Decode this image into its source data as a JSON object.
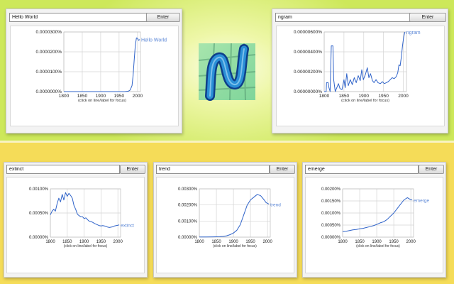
{
  "colors": {
    "accent_line": "#2f63c9",
    "legend_text": "#5a86d6",
    "grid": "#d4d4d4",
    "top_background": "#cde85a",
    "bottom_background": "#f5dc58"
  },
  "logo": {
    "icon": "ngram-viewer-logo-icon",
    "letter": "N"
  },
  "hint": "(click on line/label for focus)",
  "panels": [
    {
      "query": "Hello World",
      "button": "Enter",
      "chart_data": {
        "type": "line",
        "title": "",
        "xlim": [
          1800,
          2008
        ],
        "x_ticks": [
          "1800",
          "1850",
          "1900",
          "1950",
          "2000"
        ],
        "y_ticks": [
          "0.0000000%",
          "0.0000100%",
          "0.0000200%",
          "0.0000300%"
        ],
        "ylim": [
          0,
          3e-05
        ],
        "legend": "top-right",
        "series": [
          {
            "name": "Hello World",
            "points": [
              [
                1800,
                0
              ],
              [
                1850,
                0
              ],
              [
                1900,
                0
              ],
              [
                1950,
                0
              ],
              [
                1965,
                0
              ],
              [
                1975,
                2e-07
              ],
              [
                1980,
                8e-07
              ],
              [
                1985,
                3e-06
              ],
              [
                1988,
                8e-06
              ],
              [
                1991,
                1.6e-05
              ],
              [
                1994,
                2.3e-05
              ],
              [
                1997,
                2.7e-05
              ],
              [
                2000,
                2.68e-05
              ],
              [
                2003,
                2.58e-05
              ],
              [
                2006,
                2.62e-05
              ]
            ]
          }
        ]
      }
    },
    {
      "query": "ngram",
      "button": "Enter",
      "chart_data": {
        "type": "line",
        "title": "",
        "xlim": [
          1800,
          2008
        ],
        "x_ticks": [
          "1800",
          "1850",
          "1900",
          "1950",
          "2000"
        ],
        "y_ticks": [
          "0.00000000%",
          "0.00000200%",
          "0.00000400%",
          "0.00000600%"
        ],
        "ylim": [
          0,
          6e-06
        ],
        "legend": "top-right",
        "series": [
          {
            "name": "ngram",
            "points": [
              [
                1800,
                0
              ],
              [
                1805,
                0
              ],
              [
                1806,
                9e-07
              ],
              [
                1810,
                9e-07
              ],
              [
                1812,
                4e-07
              ],
              [
                1815,
                0
              ],
              [
                1818,
                4.6e-06
              ],
              [
                1822,
                4.6e-06
              ],
              [
                1824,
                1.2e-06
              ],
              [
                1828,
                0
              ],
              [
                1832,
                4e-07
              ],
              [
                1836,
                8e-07
              ],
              [
                1840,
                3e-07
              ],
              [
                1845,
                2e-07
              ],
              [
                1850,
                1.2e-06
              ],
              [
                1853,
                4e-07
              ],
              [
                1857,
                1.8e-06
              ],
              [
                1861,
                6e-07
              ],
              [
                1866,
                1.2e-06
              ],
              [
                1871,
                7e-07
              ],
              [
                1876,
                1.4e-06
              ],
              [
                1881,
                9e-07
              ],
              [
                1886,
                1.6e-06
              ],
              [
                1891,
                1.1e-06
              ],
              [
                1895,
                2.2e-06
              ],
              [
                1899,
                1.2e-06
              ],
              [
                1904,
                1.7e-06
              ],
              [
                1909,
                2.4e-06
              ],
              [
                1913,
                1.4e-06
              ],
              [
                1917,
                1.8e-06
              ],
              [
                1922,
                1.1e-06
              ],
              [
                1926,
                9e-07
              ],
              [
                1931,
                1.2e-06
              ],
              [
                1936,
                9e-07
              ],
              [
                1942,
                8e-07
              ],
              [
                1947,
                1e-06
              ],
              [
                1952,
                8e-07
              ],
              [
                1957,
                9e-07
              ],
              [
                1962,
                1e-06
              ],
              [
                1967,
                1.2e-06
              ],
              [
                1972,
                1.4e-06
              ],
              [
                1977,
                1.3e-06
              ],
              [
                1982,
                1.5e-06
              ],
              [
                1986,
                1.9e-06
              ],
              [
                1989,
                2.7e-06
              ],
              [
                1992,
                2.6e-06
              ],
              [
                1995,
                3.5e-06
              ],
              [
                1998,
                4.6e-06
              ],
              [
                2001,
                5.5e-06
              ],
              [
                2004,
                6e-06
              ]
            ]
          }
        ]
      }
    },
    {
      "query": "extinct",
      "button": "Enter",
      "chart_data": {
        "type": "line",
        "title": "",
        "xlim": [
          1800,
          2008
        ],
        "x_ticks": [
          "1800",
          "1850",
          "1900",
          "1950",
          "2000"
        ],
        "y_ticks": [
          "0.00000%",
          "0.00050%",
          "0.00100%"
        ],
        "ylim": [
          0,
          0.0013
        ],
        "legend": "right",
        "series": [
          {
            "name": "extinct",
            "points": [
              [
                1800,
                0.0006
              ],
              [
                1805,
                0.0007
              ],
              [
                1810,
                0.00075
              ],
              [
                1815,
                0.0007
              ],
              [
                1820,
                0.0009
              ],
              [
                1825,
                0.00105
              ],
              [
                1830,
                0.00095
              ],
              [
                1835,
                0.00115
              ],
              [
                1840,
                0.001
              ],
              [
                1845,
                0.0012
              ],
              [
                1850,
                0.0011
              ],
              [
                1855,
                0.00118
              ],
              [
                1860,
                0.00112
              ],
              [
                1865,
                0.00105
              ],
              [
                1870,
                0.00085
              ],
              [
                1875,
                0.00075
              ],
              [
                1880,
                0.00062
              ],
              [
                1885,
                0.00058
              ],
              [
                1890,
                0.00055
              ],
              [
                1895,
                0.00055
              ],
              [
                1900,
                0.0005
              ],
              [
                1905,
                0.00052
              ],
              [
                1910,
                0.00047
              ],
              [
                1915,
                0.00043
              ],
              [
                1920,
                0.00042
              ],
              [
                1925,
                0.0004
              ],
              [
                1930,
                0.00037
              ],
              [
                1935,
                0.00035
              ],
              [
                1940,
                0.00033
              ],
              [
                1945,
                0.00031
              ],
              [
                1950,
                0.0003
              ],
              [
                1955,
                0.00031
              ],
              [
                1960,
                0.0003
              ],
              [
                1965,
                0.00029
              ],
              [
                1970,
                0.00027
              ],
              [
                1975,
                0.00026
              ],
              [
                1980,
                0.00027
              ],
              [
                1985,
                0.00028
              ],
              [
                1990,
                0.0003
              ],
              [
                1995,
                0.00031
              ],
              [
                2000,
                0.00032
              ],
              [
                2004,
                0.00033
              ]
            ]
          }
        ]
      }
    },
    {
      "query": "trend",
      "button": "Enter",
      "chart_data": {
        "type": "line",
        "title": "",
        "xlim": [
          1800,
          2008
        ],
        "x_ticks": [
          "1800",
          "1850",
          "1900",
          "1950",
          "2000"
        ],
        "y_ticks": [
          "0.00000%",
          "0.00100%",
          "0.00200%",
          "0.00300%"
        ],
        "ylim": [
          0,
          0.0035
        ],
        "legend": "right",
        "series": [
          {
            "name": "trend",
            "points": [
              [
                1800,
                1e-05
              ],
              [
                1820,
                1e-05
              ],
              [
                1840,
                2e-05
              ],
              [
                1860,
                3e-05
              ],
              [
                1870,
                5e-05
              ],
              [
                1880,
                0.0001
              ],
              [
                1890,
                0.00018
              ],
              [
                1900,
                0.0003
              ],
              [
                1910,
                0.0005
              ],
              [
                1920,
                0.0009
              ],
              [
                1930,
                0.0016
              ],
              [
                1940,
                0.0023
              ],
              [
                1950,
                0.0027
              ],
              [
                1960,
                0.0029
              ],
              [
                1970,
                0.0031
              ],
              [
                1980,
                0.003
              ],
              [
                1990,
                0.0027
              ],
              [
                1996,
                0.0025
              ],
              [
                2004,
                0.0024
              ]
            ]
          }
        ]
      }
    },
    {
      "query": "emerge",
      "button": "Enter",
      "chart_data": {
        "type": "line",
        "title": "",
        "xlim": [
          1800,
          2008
        ],
        "x_ticks": [
          "1800",
          "1850",
          "1900",
          "1950",
          "2000"
        ],
        "y_ticks": [
          "0.00000%",
          "0.00050%",
          "0.00100%",
          "0.00150%",
          "0.00200%"
        ],
        "ylim": [
          0,
          0.0022
        ],
        "legend": "right",
        "series": [
          {
            "name": "emerge",
            "points": [
              [
                1800,
                0.00025
              ],
              [
                1810,
                0.00027
              ],
              [
                1820,
                0.0003
              ],
              [
                1830,
                0.00033
              ],
              [
                1840,
                0.00035
              ],
              [
                1850,
                0.00038
              ],
              [
                1860,
                0.0004
              ],
              [
                1870,
                0.00044
              ],
              [
                1880,
                0.00048
              ],
              [
                1890,
                0.00052
              ],
              [
                1900,
                0.00058
              ],
              [
                1910,
                0.00065
              ],
              [
                1920,
                0.0007
              ],
              [
                1930,
                0.0008
              ],
              [
                1940,
                0.00095
              ],
              [
                1950,
                0.0011
              ],
              [
                1960,
                0.0013
              ],
              [
                1970,
                0.0015
              ],
              [
                1980,
                0.0017
              ],
              [
                1990,
                0.0018
              ],
              [
                1995,
                0.00175
              ],
              [
                2000,
                0.0017
              ],
              [
                2004,
                0.0017
              ]
            ]
          }
        ]
      }
    }
  ]
}
